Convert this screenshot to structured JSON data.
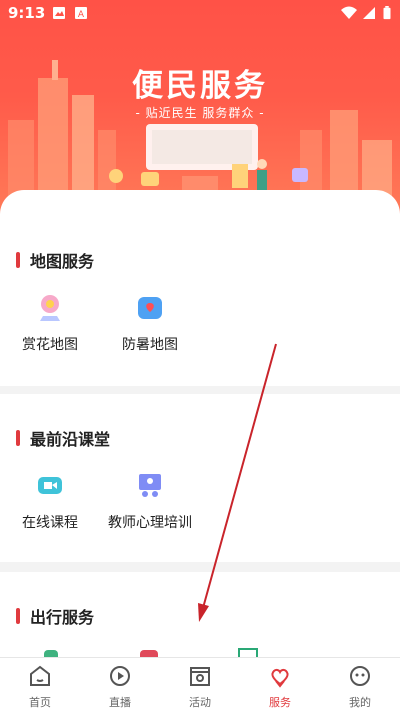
{
  "status_bar": {
    "time": "9:13"
  },
  "hero": {
    "title": "便民服务",
    "subtitle": "- 贴近民生  服务群众 -"
  },
  "sections": [
    {
      "title": "地图服务",
      "items": [
        {
          "label": "赏花地图",
          "icon": "flower-map-icon"
        },
        {
          "label": "防暑地图",
          "icon": "heat-map-icon"
        }
      ]
    },
    {
      "title": "最前沿课堂",
      "items": [
        {
          "label": "在线课程",
          "icon": "online-course-icon"
        },
        {
          "label": "教师心理培训",
          "icon": "teacher-training-icon"
        }
      ]
    },
    {
      "title": "出行服务",
      "items": []
    }
  ],
  "nav": [
    {
      "label": "首页",
      "icon": "home-icon"
    },
    {
      "label": "直播",
      "icon": "live-icon"
    },
    {
      "label": "活动",
      "icon": "activity-icon"
    },
    {
      "label": "服务",
      "icon": "service-icon",
      "active": true
    },
    {
      "label": "我的",
      "icon": "profile-icon"
    }
  ],
  "colors": {
    "accent": "#e03a3e",
    "hero": "#ff5247"
  }
}
